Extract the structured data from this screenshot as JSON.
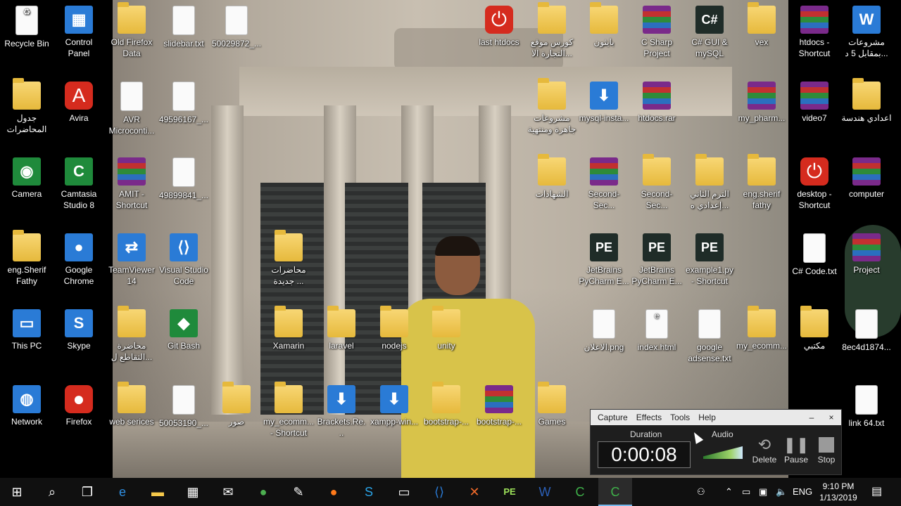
{
  "desktop": {
    "left_icons": [
      {
        "label": "Recycle Bin",
        "icon": "recycle-bin-icon"
      },
      {
        "label": "Control Panel",
        "icon": "control-panel-icon"
      },
      {
        "label": "جدول المحاضرات",
        "icon": "folder-icon"
      },
      {
        "label": "Avira",
        "icon": "avira-icon"
      },
      {
        "label": "Camera",
        "icon": "camera-icon"
      },
      {
        "label": "Camtasia Studio 8",
        "icon": "camtasia-icon"
      },
      {
        "label": "eng.Sherif Fathy",
        "icon": "folder-icon"
      },
      {
        "label": "Google Chrome",
        "icon": "chrome-icon"
      },
      {
        "label": "This PC",
        "icon": "this-pc-icon"
      },
      {
        "label": "Skype",
        "icon": "skype-icon"
      },
      {
        "label": "Network",
        "icon": "network-icon"
      },
      {
        "label": "Firefox",
        "icon": "firefox-icon"
      }
    ],
    "wall_icons": [
      {
        "label": "Old Firefox Data",
        "icon": "folder-icon"
      },
      {
        "label": "slidebar.txt",
        "icon": "text-file-icon"
      },
      {
        "label": "50029872_...",
        "icon": "image-file-icon"
      },
      {
        "label": "last htdocs",
        "icon": "power-icon"
      },
      {
        "label": "كورس موقع التجارة الا...",
        "icon": "folder-icon"
      },
      {
        "label": "بايثون",
        "icon": "folder-icon"
      },
      {
        "label": "C Sharp Project",
        "icon": "winrar-icon"
      },
      {
        "label": "C# GUI & mySQL",
        "icon": "csharp-icon"
      },
      {
        "label": "vex",
        "icon": "folder-icon"
      },
      {
        "label": "AVR Microconti...",
        "icon": "pdf-icon"
      },
      {
        "label": "49596167_...",
        "icon": "document-icon"
      },
      {
        "label": "مشروعات جاهزة ومنتهية",
        "icon": "folder-icon"
      },
      {
        "label": "mysql-insta...",
        "icon": "installer-icon"
      },
      {
        "label": "htdocs.rar",
        "icon": "winrar-icon"
      },
      {
        "label": "my_pharm...",
        "icon": "winrar-icon"
      },
      {
        "label": "AMIT - Shortcut",
        "icon": "winrar-icon"
      },
      {
        "label": "49899841_...",
        "icon": "document-icon"
      },
      {
        "label": "الشهادات",
        "icon": "folder-icon"
      },
      {
        "label": "Second-Sec...",
        "icon": "winrar-icon"
      },
      {
        "label": "Second-Sec...",
        "icon": "folder-icon"
      },
      {
        "label": "الترم الثاني إعدادي ه...",
        "icon": "folder-icon"
      },
      {
        "label": "eng.sherif fathy",
        "icon": "folder-icon"
      },
      {
        "label": "TeamViewer 14",
        "icon": "teamviewer-icon"
      },
      {
        "label": "Visual Studio Code",
        "icon": "vscode-icon"
      },
      {
        "label": "محاضرات جديدة ...",
        "icon": "folder-icon"
      },
      {
        "label": "JetBrains PyCharm E...",
        "icon": "pycharm-icon"
      },
      {
        "label": "JetBrains PyCharm E...",
        "icon": "pycharm-icon"
      },
      {
        "label": "example1.py - Shortcut",
        "icon": "pycharm-icon"
      },
      {
        "label": "محاضرة التقاطع ل...",
        "icon": "folder-icon"
      },
      {
        "label": "Git Bash",
        "icon": "git-icon"
      },
      {
        "label": "Xamarin",
        "icon": "folder-icon"
      },
      {
        "label": "laravel",
        "icon": "folder-icon"
      },
      {
        "label": "nodejs",
        "icon": "folder-icon"
      },
      {
        "label": "unity",
        "icon": "folder-icon"
      },
      {
        "label": "الاعلان.png",
        "icon": "image-file-icon"
      },
      {
        "label": "index.html",
        "icon": "edge-html-icon"
      },
      {
        "label": "google adsense.txt",
        "icon": "text-file-icon"
      },
      {
        "label": "my_ecomm...",
        "icon": "folder-icon"
      },
      {
        "label": "web serices",
        "icon": "folder-icon"
      },
      {
        "label": "50053190_...",
        "icon": "image-file-icon"
      },
      {
        "label": "صور",
        "icon": "folder-icon"
      },
      {
        "label": "my_ecomm... - Shortcut",
        "icon": "folder-icon"
      },
      {
        "label": "Brackets.Re...",
        "icon": "installer-icon"
      },
      {
        "label": "xampp-win...",
        "icon": "installer-icon"
      },
      {
        "label": "bootstrap-...",
        "icon": "folder-icon"
      },
      {
        "label": "bootstrap-...",
        "icon": "winrar-icon"
      },
      {
        "label": "Games",
        "icon": "folder-icon"
      }
    ],
    "right_icons": [
      {
        "label": "htdocs - Shortcut",
        "icon": "winrar-icon"
      },
      {
        "label": "مشروعات بمقابل 5 د...",
        "icon": "word-icon"
      },
      {
        "label": "video7",
        "icon": "winrar-icon"
      },
      {
        "label": "اعدادي هندسة",
        "icon": "folder-icon"
      },
      {
        "label": "desktop - Shortcut",
        "icon": "power-icon"
      },
      {
        "label": "computer",
        "icon": "winrar-icon"
      },
      {
        "label": "C# Code.txt",
        "icon": "text-file-icon"
      },
      {
        "label": "Project",
        "icon": "winrar-icon"
      },
      {
        "label": "مكتبي",
        "icon": "folder-icon"
      },
      {
        "label": "8ec4d1874...",
        "icon": "image-file-icon"
      },
      {
        "label": "link 64.txt",
        "icon": "text-file-icon"
      }
    ]
  },
  "capture_panel": {
    "menu": [
      "Capture",
      "Effects",
      "Tools",
      "Help"
    ],
    "duration_label": "Duration",
    "timer": "0:00:08",
    "audio_label": "Audio",
    "delete_label": "Delete",
    "pause_label": "Pause",
    "stop_label": "Stop",
    "minimize": "–",
    "close": "×"
  },
  "taskbar": {
    "apps": [
      "start-icon",
      "search-icon",
      "task-view-icon",
      "edge-icon",
      "file-explorer-icon",
      "store-icon",
      "mail-icon",
      "chrome-icon",
      "paint-icon",
      "firefox-icon",
      "skype-icon",
      "terminal-icon",
      "vscode-icon",
      "xampp-icon",
      "pycharm-icon",
      "word-icon",
      "camtasia-icon",
      "camtasia-recorder-icon"
    ],
    "language": "ENG",
    "time": "9:10 PM",
    "date": "1/13/2019"
  }
}
